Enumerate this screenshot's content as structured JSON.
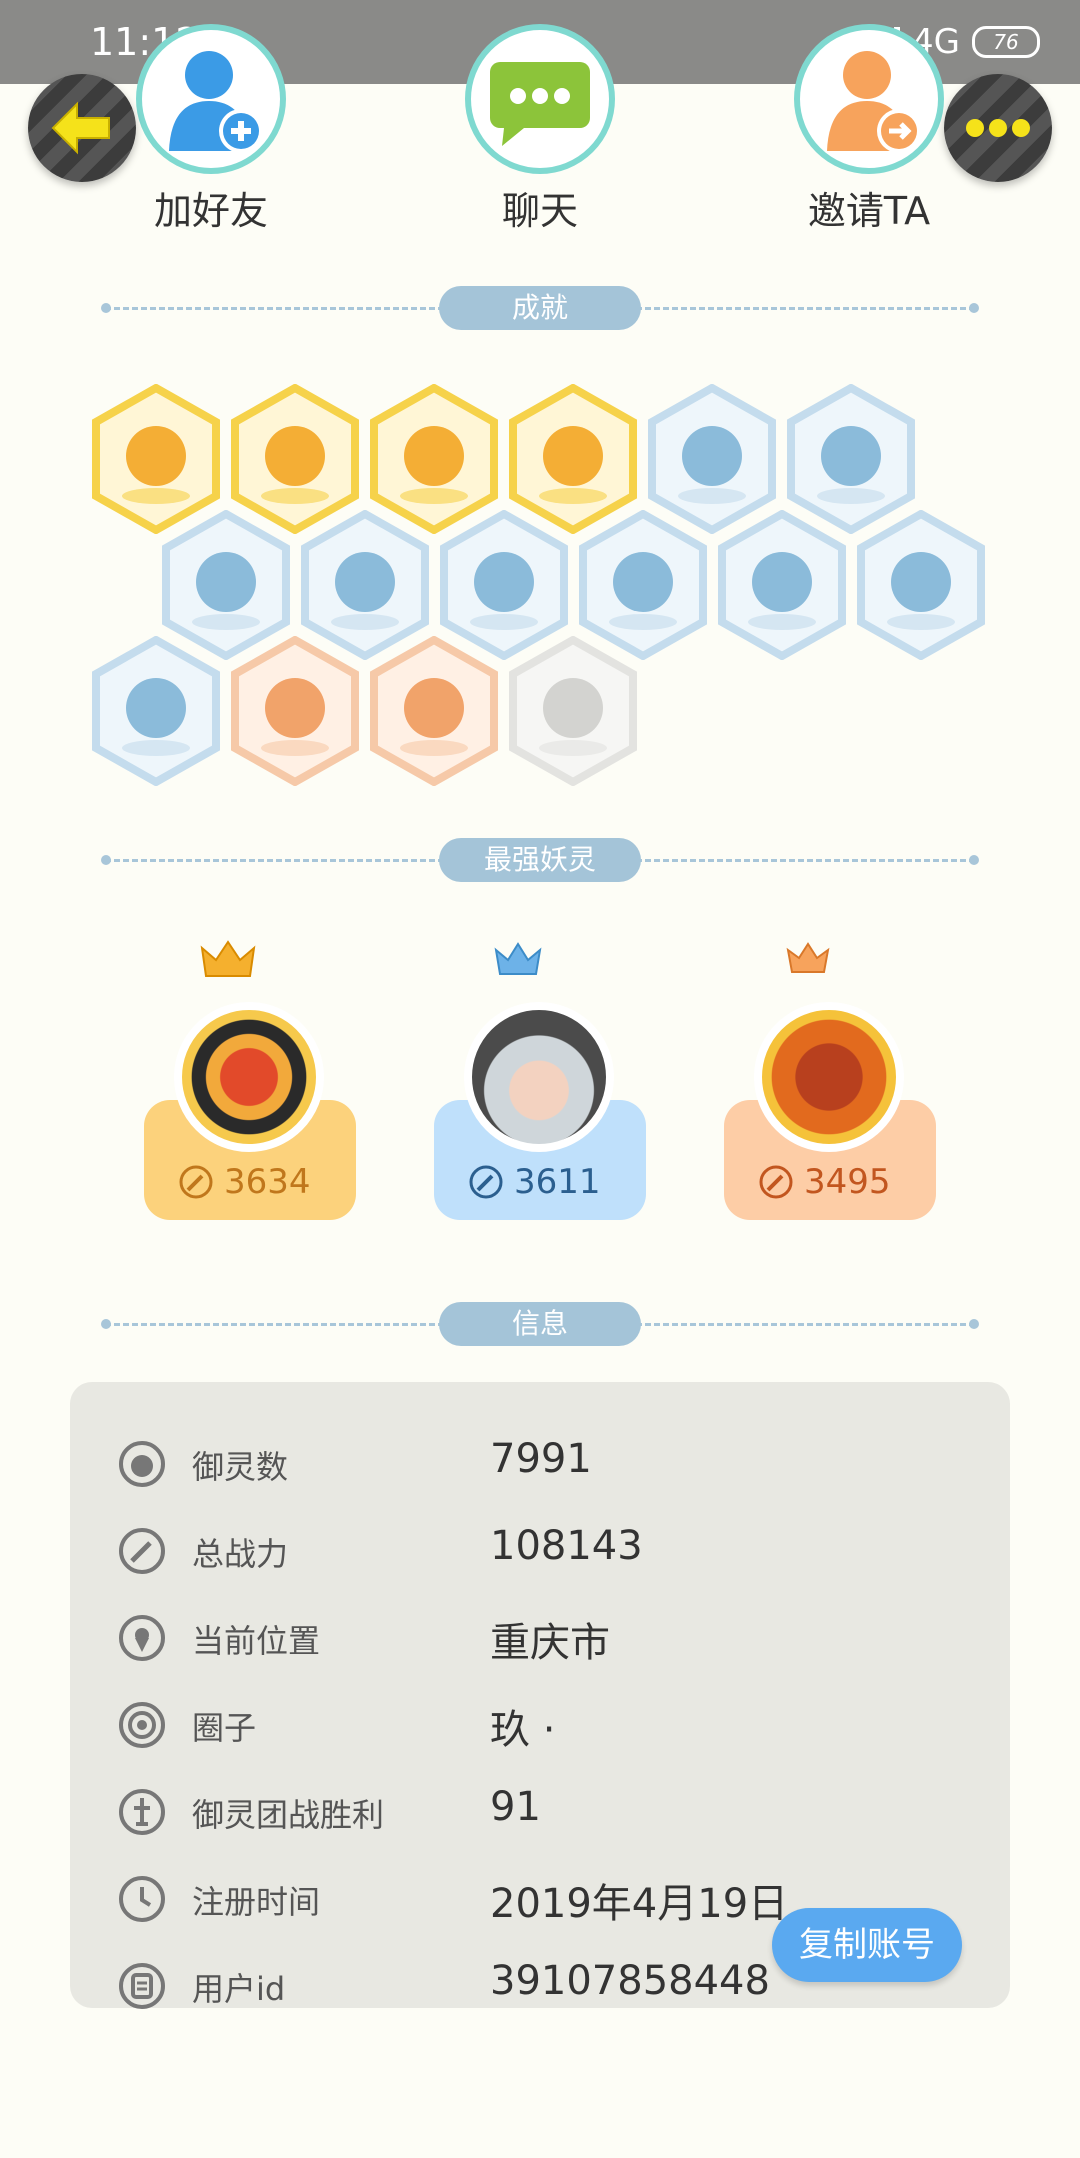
{
  "status": {
    "time": "11:12",
    "network": "4G",
    "battery": "76"
  },
  "nav": {
    "back_icon": "back-arrow-icon",
    "more_icon": "more-dots-icon"
  },
  "actions": [
    {
      "label": "加好友",
      "icon": "add-friend-icon"
    },
    {
      "label": "聊天",
      "icon": "chat-icon"
    },
    {
      "label": "邀请TA",
      "icon": "invite-icon"
    }
  ],
  "sections": {
    "achievements": "成就",
    "strongest": "最强妖灵",
    "info": "信息"
  },
  "achievements": [
    {
      "tier": "gold",
      "icon": "sun-flower-icon"
    },
    {
      "tier": "gold",
      "icon": "fox-face-icon"
    },
    {
      "tier": "gold",
      "icon": "orb-icon"
    },
    {
      "tier": "gold",
      "icon": "yin-yang-book-icon"
    },
    {
      "tier": "blue",
      "icon": "sneaker-icon"
    },
    {
      "tier": "blue",
      "icon": "moon-icon"
    },
    {
      "tier": "blue",
      "icon": "crystal-icon"
    },
    {
      "tier": "blue",
      "icon": "taiji-wave-icon"
    },
    {
      "tier": "blue",
      "icon": "monster-icon"
    },
    {
      "tier": "blue",
      "icon": "cat-balloon-icon"
    },
    {
      "tier": "blue",
      "icon": "shield-icon"
    },
    {
      "tier": "blue",
      "icon": "cat-silhouette-icon"
    },
    {
      "tier": "blue",
      "icon": "cat-book-icon"
    },
    {
      "tier": "orange",
      "icon": "stroller-cat-icon"
    },
    {
      "tier": "orange",
      "icon": "bull-cat-icon"
    },
    {
      "tier": "grey",
      "icon": "dragon-icon"
    }
  ],
  "strongest": [
    {
      "power": "3634",
      "crown": "gold-crown-icon",
      "color": "#fcd27c",
      "text_color": "#c0771c"
    },
    {
      "power": "3611",
      "crown": "blue-crown-icon",
      "color": "#bfe0fb",
      "text_color": "#2b5f8f"
    },
    {
      "power": "3495",
      "crown": "orange-crown-icon",
      "color": "#fdcda6",
      "text_color": "#c2561f"
    }
  ],
  "info": [
    {
      "key": "御灵数",
      "value": "7991",
      "icon": "spirit-count-icon"
    },
    {
      "key": "总战力",
      "value": "108143",
      "icon": "sword-icon"
    },
    {
      "key": "当前位置",
      "value": "重庆市",
      "icon": "location-pin-icon"
    },
    {
      "key": "圈子",
      "value": "玖 ·",
      "icon": "circle-icon"
    },
    {
      "key": "御灵团战胜利",
      "value": "91",
      "icon": "trophy-icon"
    },
    {
      "key": "注册时间",
      "value": "2019年4月19日",
      "icon": "clock-icon"
    },
    {
      "key": "用户id",
      "value": "39107858448",
      "icon": "id-card-icon"
    }
  ],
  "copy_button": "复制账号"
}
